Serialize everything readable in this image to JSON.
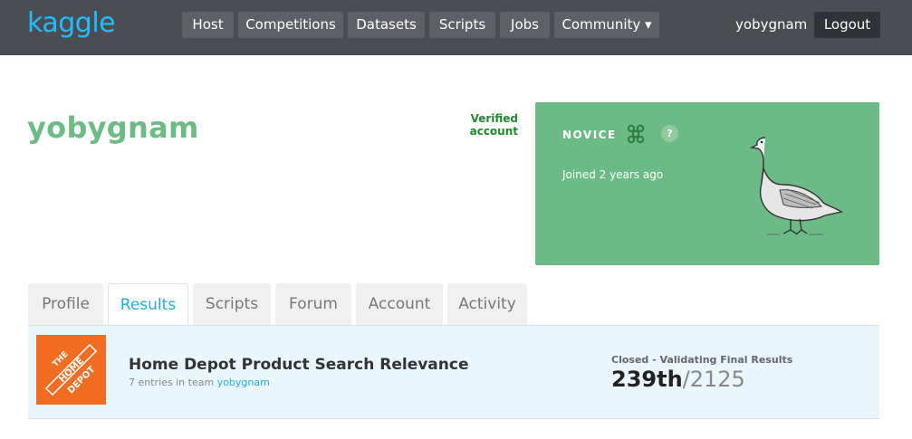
{
  "app": {
    "logo_text": "kaggle",
    "brand_color": "#20beff"
  },
  "nav": {
    "items": [
      {
        "label": "Host"
      },
      {
        "label": "Competitions"
      },
      {
        "label": "Datasets"
      },
      {
        "label": "Scripts"
      },
      {
        "label": "Jobs"
      },
      {
        "label": "Community ▾"
      }
    ],
    "username": "yobygnam",
    "logout_label": "Logout"
  },
  "profile": {
    "name": "yobygnam",
    "verified": "Verified account",
    "tier": "NOVICE",
    "tier_color": "#6cbb85",
    "help": "?",
    "joined": "Joined 2 years ago"
  },
  "tabs": [
    {
      "label": "Profile"
    },
    {
      "label": "Results"
    },
    {
      "label": "Scripts"
    },
    {
      "label": "Forum"
    },
    {
      "label": "Account"
    },
    {
      "label": "Activity"
    }
  ],
  "active_tab": "Results",
  "results": [
    {
      "logo_icon": "home-depot-logo",
      "title": "Home Depot Product Search Relevance",
      "entries_prefix": "7 entries in team",
      "team": "yobygnam",
      "status": "Closed - Validating Final Results",
      "rank": "239th",
      "total": "/2125"
    }
  ]
}
